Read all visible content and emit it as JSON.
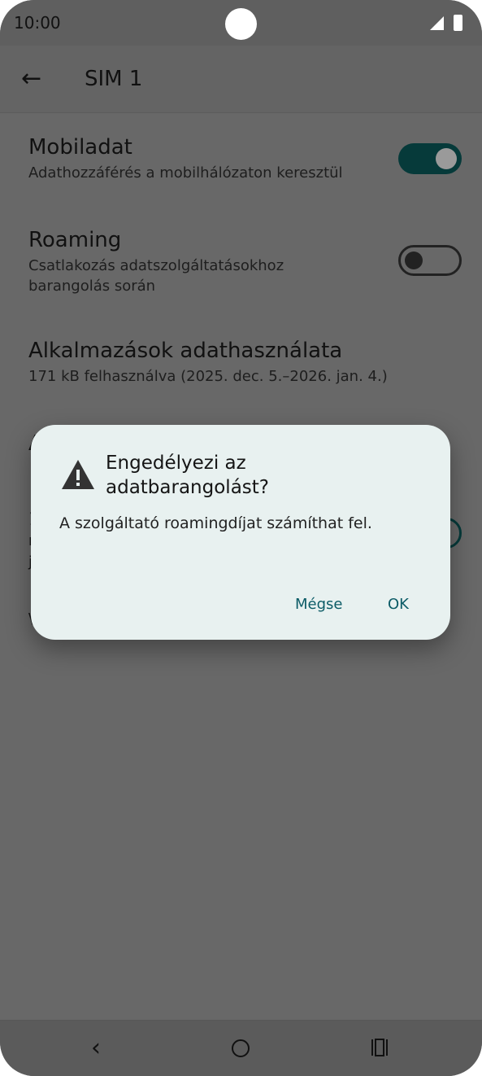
{
  "status_bar": {
    "time": "10:00"
  },
  "app_bar": {
    "title": "SIM 1"
  },
  "settings": [
    {
      "title": "Mobiladat",
      "subtitle": "Adathozzáférés a mobilhálózaton keresztül",
      "toggle": "on"
    },
    {
      "title": "Roaming",
      "subtitle": "Csatlakozás adatszolgáltatásokhoz barangolás során",
      "toggle": "off"
    },
    {
      "title": "Alkalmazások adathasználata",
      "subtitle": "171 kB felhasználva (2025. dec. 5.–2026. jan. 4.)"
    }
  ],
  "obscured": {
    "line1": "A",
    "line2": "1",
    "line3": "r",
    "line4": "j",
    "line5": "\\"
  },
  "dialog": {
    "title": "Engedélyezi az adatbarangolást?",
    "message": "A szolgáltató roamingdíjat számíthat fel.",
    "cancel_label": "Mégse",
    "ok_label": "OK"
  },
  "colors": {
    "accent": "#0b5b66",
    "toggle_on": "#063a3a",
    "dialog_bg": "#e8f1f0",
    "scrim": "#686868"
  },
  "icons": {
    "back": "arrow-left-icon",
    "warning": "warning-icon",
    "nav_back": "chevron-left-icon",
    "nav_home": "home-circle-icon",
    "nav_recent": "recent-apps-icon"
  }
}
